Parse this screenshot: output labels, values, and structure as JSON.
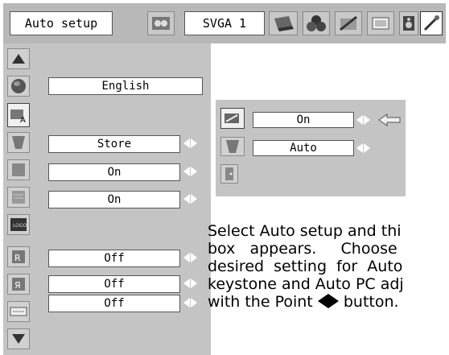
{
  "menu": {
    "title": "Auto setup",
    "input_label": "SVGA 1",
    "top_icons": [
      "pc-adjust-icon",
      "laptop-icon",
      "color-icon",
      "image-icon",
      "sound-icon",
      "setting-icon"
    ]
  },
  "side_icons": [
    "scroll-up-icon",
    "globe-icon",
    "auto-setup-icon",
    "keystone-icon",
    "background-icon",
    "display-icon",
    "logo-icon",
    "ceiling-icon",
    "rear-icon",
    "terminal-icon",
    "scroll-down-icon"
  ],
  "settings": {
    "language": "English",
    "keystone": "Store",
    "background_on": "On",
    "display_on": "On",
    "ceiling": "Off",
    "rear": "Off",
    "terminal": "Off"
  },
  "auto_setup_submenu": {
    "pc_adjust": "On",
    "keystone": "Auto"
  },
  "description": {
    "line1": "Select Auto setup and thi",
    "line2": "box   appears.     Choose",
    "line3": "desired  setting  for  Auto",
    "line4": "keystone and Auto PC adj",
    "line5_pre": "with the Point ",
    "line5_post": " button."
  },
  "colors": {
    "panel": "#c4c4c4",
    "topbar": "#b8b8b8",
    "field": "#ffffff"
  }
}
